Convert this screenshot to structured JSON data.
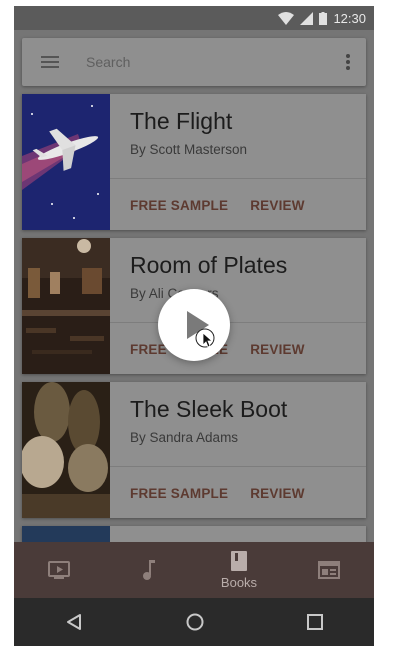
{
  "status_bar": {
    "time": "12:30"
  },
  "search": {
    "placeholder": "Search"
  },
  "books": [
    {
      "title": "The Flight",
      "author": "By Scott Masterson",
      "actions": [
        "FREE SAMPLE",
        "REVIEW"
      ]
    },
    {
      "title": "Room of Plates",
      "author": "By Ali Connors",
      "actions": [
        "FREE SAMPLE",
        "REVIEW"
      ]
    },
    {
      "title": "The Sleek Boot",
      "author": "By Sandra Adams",
      "actions": [
        "FREE SAMPLE",
        "REVIEW"
      ]
    }
  ],
  "bottom_nav": [
    {
      "icon": "tv-icon",
      "label": ""
    },
    {
      "icon": "music-note-icon",
      "label": ""
    },
    {
      "icon": "book-icon",
      "label": "Books",
      "active": true
    },
    {
      "icon": "newsstand-icon",
      "label": ""
    }
  ],
  "system_nav": [
    "back-icon",
    "home-icon",
    "recents-icon"
  ],
  "colors": {
    "overlay_dim": "#7a7a7a",
    "accent_text": "#5d3a30",
    "bottom_nav_bg": "#4a3b39",
    "system_nav_bg": "#2a2a2a"
  }
}
